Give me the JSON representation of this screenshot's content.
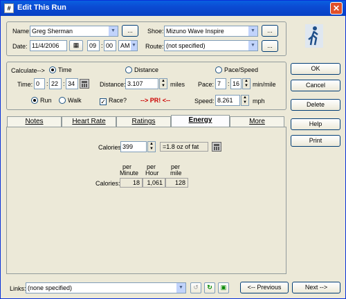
{
  "window": {
    "title": "Edit This Run",
    "app_icon_glyph": "#"
  },
  "top": {
    "name_label": "Name:",
    "name_value": "Greg Sherman",
    "shoe_label": "Shoe:",
    "shoe_value": "Mizuno Wave Inspire",
    "date_label": "Date:",
    "date_value": "11/4/2006",
    "time_hour": "09",
    "time_min": "00",
    "time_ampm": "AM",
    "route_label": "Route:",
    "route_value": "(not specified)",
    "ellipsis": "..."
  },
  "calc": {
    "calculate_label": "Calculate-->",
    "opt_time": "Time",
    "opt_distance": "Distance",
    "opt_pace": "Pace/Speed",
    "time_label": "Time:",
    "time_h": "0",
    "time_m": "22",
    "time_s": "34",
    "distance_label": "Distance:",
    "distance_value": "3.107",
    "distance_unit": "miles",
    "pace_label": "Pace:",
    "pace_min": "7",
    "pace_sec": "16",
    "pace_unit": "min/mile",
    "speed_label": "Speed:",
    "speed_value": "8.261",
    "speed_unit": "mph",
    "run_label": "Run",
    "walk_label": "Walk",
    "race_label": "Race?",
    "pr_text": "--> PR! <--",
    "selected_calc": "Time",
    "selected_activity": "Run",
    "race_checked": true
  },
  "tabs": [
    "Notes",
    "Heart Rate",
    "Ratings",
    "Energy",
    "More"
  ],
  "active_tab": "Energy",
  "energy": {
    "calories_label": "Calories:",
    "calories_value": "399",
    "fat_text": "=1.8 oz of fat",
    "per_minute_l1": "per",
    "per_minute_l2": "Minute",
    "per_hour_l1": "per",
    "per_hour_l2": "Hour",
    "per_mile_l1": "per",
    "per_mile_l2": "mile",
    "per_minute": "18",
    "per_hour": "1,061",
    "per_mile": "128"
  },
  "buttons": {
    "ok": "OK",
    "cancel": "Cancel",
    "delete": "Delete",
    "help": "Help",
    "print": "Print"
  },
  "bottom": {
    "links_label": "Links:",
    "links_value": "(none specified)",
    "previous": "<-- Previous",
    "next": "Next -->"
  },
  "colors": {
    "title_bar": "#0a5fe0",
    "pr_text": "#cc0000",
    "close": "#e0502a"
  }
}
